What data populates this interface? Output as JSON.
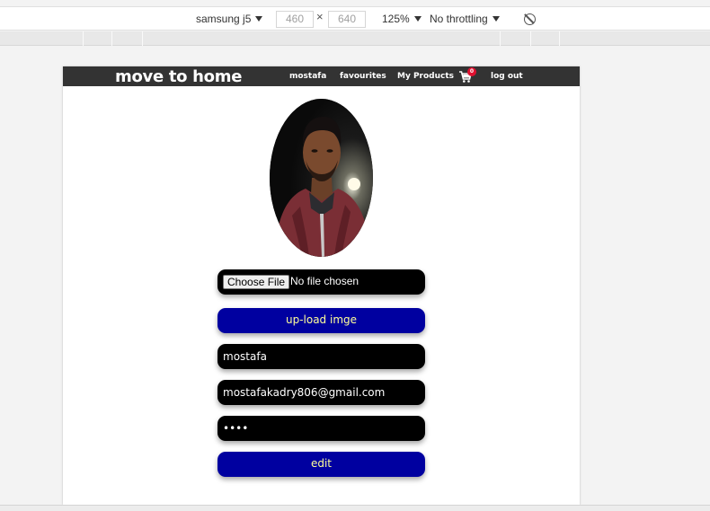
{
  "devtools": {
    "device": "samsung j5",
    "width": "460",
    "height": "640",
    "zoom": "125%",
    "throttling": "No throttling"
  },
  "navbar": {
    "brand": "move to home",
    "links": [
      "mostafa",
      "favourites",
      "My Products"
    ],
    "cart_count": "0",
    "logout": "log out"
  },
  "profile": {
    "file_button": "Choose File",
    "file_status": "No file chosen",
    "upload_label": "up-load imge",
    "name_value": "mostafa",
    "email_value": "mostafakadry806@gmail.com",
    "password_value": "1234",
    "edit_label": "edit"
  },
  "colors": {
    "navbar": "#333333",
    "button": "#0000a0",
    "button_text": "#ffff9a",
    "input": "#000000"
  }
}
